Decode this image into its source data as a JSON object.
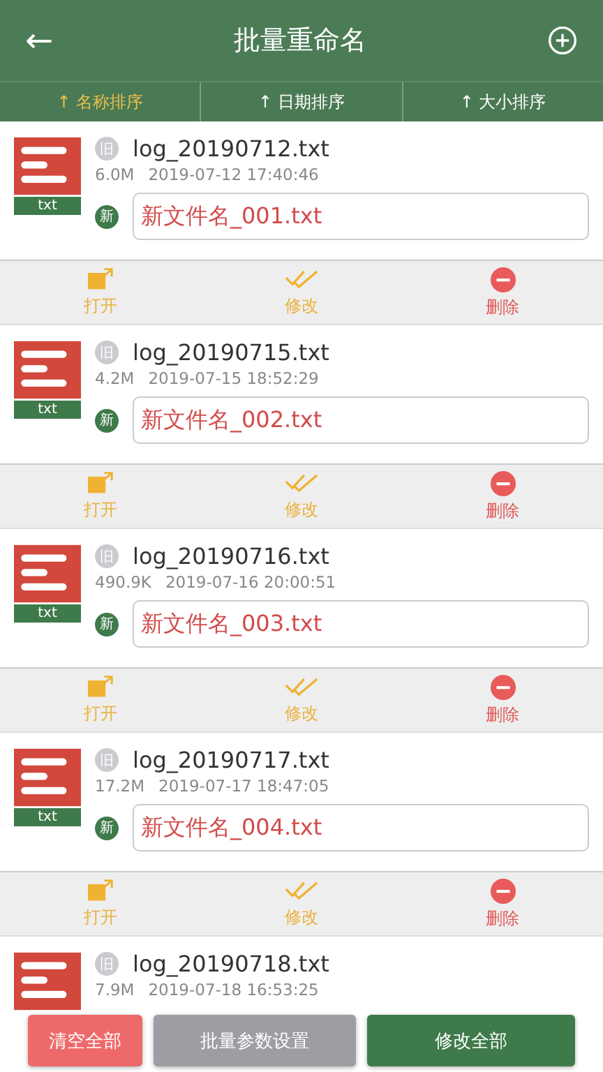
{
  "header": {
    "back": "←",
    "title": "批量重命名"
  },
  "sort_tabs": [
    {
      "label": "↑ 名称排序",
      "selected": true
    },
    {
      "label": "↑ 日期排序",
      "selected": false
    },
    {
      "label": "↑ 大小排序",
      "selected": false
    }
  ],
  "files": [
    {
      "type_label": "txt",
      "old_badge": "旧",
      "name": "log_20190712.txt",
      "size": "6.0M",
      "date": "2019-07-12 17:40:46",
      "new_badge": "新",
      "new_name": "新文件名_001.txt",
      "actions": [
        {
          "kind": "open",
          "label": "打开"
        },
        {
          "kind": "modify",
          "label": "修改"
        },
        {
          "kind": "delete",
          "label": "删除"
        }
      ]
    },
    {
      "type_label": "txt",
      "old_badge": "旧",
      "name": "log_20190715.txt",
      "size": "4.2M",
      "date": "2019-07-15 18:52:29",
      "new_badge": "新",
      "new_name": "新文件名_002.txt",
      "actions": [
        {
          "kind": "open",
          "label": "打开"
        },
        {
          "kind": "modify",
          "label": "修改"
        },
        {
          "kind": "delete",
          "label": "删除"
        }
      ]
    },
    {
      "type_label": "txt",
      "old_badge": "旧",
      "name": "log_20190716.txt",
      "size": "490.9K",
      "date": "2019-07-16 20:00:51",
      "new_badge": "新",
      "new_name": "新文件名_003.txt",
      "actions": [
        {
          "kind": "open",
          "label": "打开"
        },
        {
          "kind": "modify",
          "label": "修改"
        },
        {
          "kind": "delete",
          "label": "删除"
        }
      ]
    },
    {
      "type_label": "txt",
      "old_badge": "旧",
      "name": "log_20190717.txt",
      "size": "17.2M",
      "date": "2019-07-17 18:47:05",
      "new_badge": "新",
      "new_name": "新文件名_004.txt",
      "actions": [
        {
          "kind": "open",
          "label": "打开"
        },
        {
          "kind": "modify",
          "label": "修改"
        },
        {
          "kind": "delete",
          "label": "删除"
        }
      ]
    },
    {
      "old_badge": "旧",
      "name": "log_20190718.txt",
      "size": "7.9M",
      "date": "2019-07-18 16:53:25"
    }
  ],
  "bottom_buttons": [
    {
      "kind": "clear",
      "label": "清空全部"
    },
    {
      "kind": "settings",
      "label": "批量参数设置"
    },
    {
      "kind": "apply",
      "label": "修改全部"
    }
  ]
}
